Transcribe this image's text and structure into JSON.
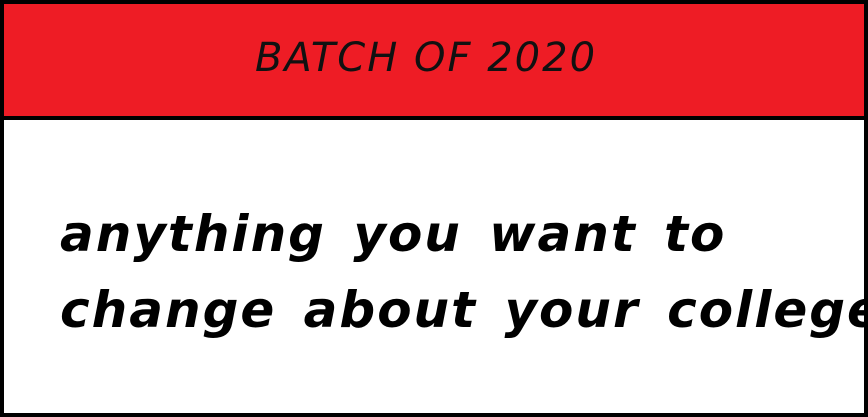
{
  "header": {
    "title": "BATCH OF 2020",
    "background_color": "#ee1c25"
  },
  "prompt": {
    "lines": [
      "anything you want to",
      "change about your college"
    ]
  },
  "colors": {
    "border": "#000000",
    "text": "#000000",
    "body_background": "#ffffff"
  }
}
